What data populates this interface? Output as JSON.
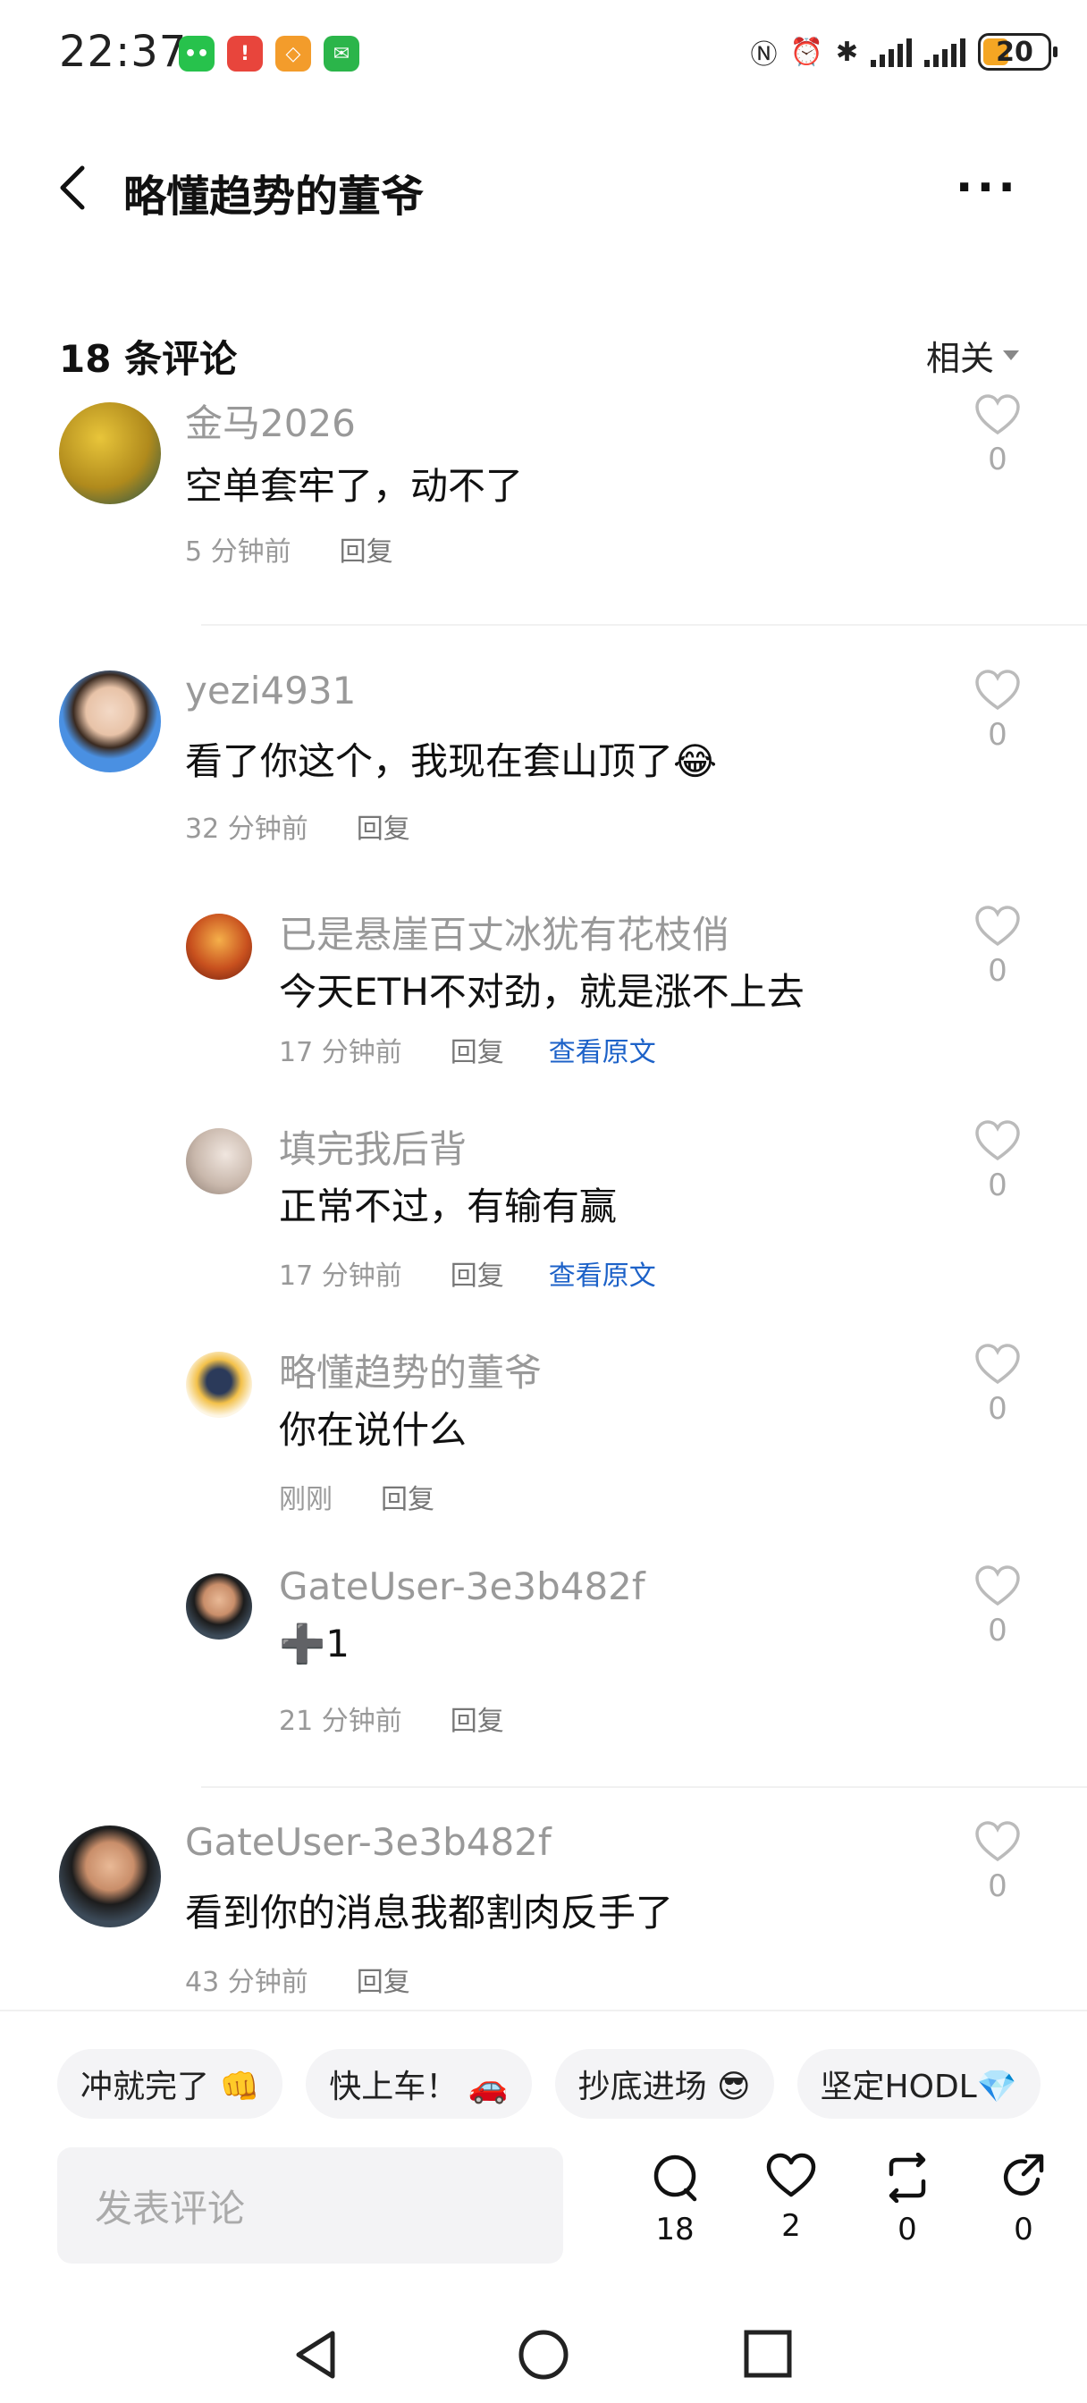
{
  "status": {
    "time": "22:37",
    "battery": "20"
  },
  "header": {
    "title": "略懂趋势的董爷"
  },
  "comments_header": {
    "count_label": "18 条评论",
    "sort_label": "相关"
  },
  "comments": [
    {
      "user": "金马2026",
      "text": "空单套牢了，动不了",
      "time": "5 分钟前",
      "reply": "回复",
      "likes": "0"
    },
    {
      "user": "yezi4931",
      "text": "看了你这个，我现在套山顶了😂",
      "time": "32 分钟前",
      "reply": "回复",
      "likes": "0"
    },
    {
      "user": "已是悬崖百丈冰犹有花枝俏",
      "text": "今天ETH不对劲，就是涨不上去",
      "time": "17 分钟前",
      "reply": "回复",
      "view_original": "查看原文",
      "likes": "0"
    },
    {
      "user": "填完我后背",
      "text": "正常不过，有输有赢",
      "time": "17 分钟前",
      "reply": "回复",
      "view_original": "查看原文",
      "likes": "0"
    },
    {
      "user": "略懂趋势的董爷",
      "text": "你在说什么",
      "time": "刚刚",
      "reply": "回复",
      "likes": "0"
    },
    {
      "user": "GateUser-3e3b482f",
      "text": "➕1",
      "time": "21 分钟前",
      "reply": "回复",
      "likes": "0"
    },
    {
      "user": "GateUser-3e3b482f",
      "text": "看到你的消息我都割肉反手了",
      "time": "43 分钟前",
      "reply": "回复",
      "likes": "0"
    }
  ],
  "quick_replies": [
    "冲就完了 👊",
    "快上车！ 🚗",
    "抄底进场 😎",
    "坚定HODL💎"
  ],
  "composer": {
    "placeholder": "发表评论"
  },
  "actions": {
    "comments": "18",
    "likes": "2",
    "reposts": "0",
    "shares": "0"
  }
}
